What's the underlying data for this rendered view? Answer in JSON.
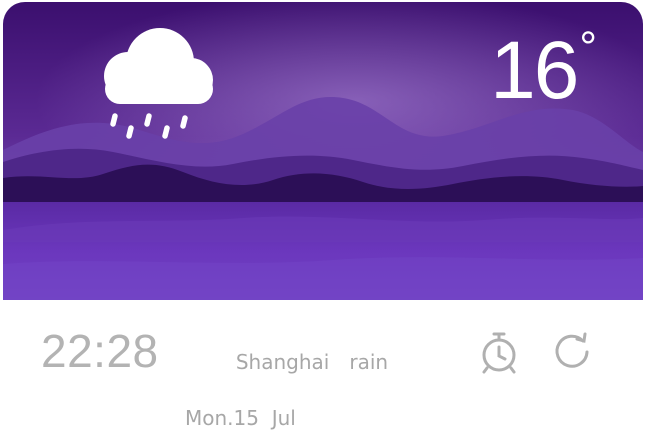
{
  "weather": {
    "temperature": "16",
    "unit": "°",
    "condition_icon": "rain-cloud-icon"
  },
  "footer": {
    "time": "22:28",
    "city": "Shanghai",
    "condition": "rain",
    "date": "Mon.15  Jul"
  },
  "actions": {
    "alarm_icon": "alarm-clock-icon",
    "refresh_icon": "refresh-icon"
  },
  "colors": {
    "sky_top": "#3d1170",
    "sky_glow": "#9a6fc9",
    "water": "#6a35ba",
    "footer_text": "#b3b3b3",
    "icon_gray": "#b0b0b0"
  }
}
